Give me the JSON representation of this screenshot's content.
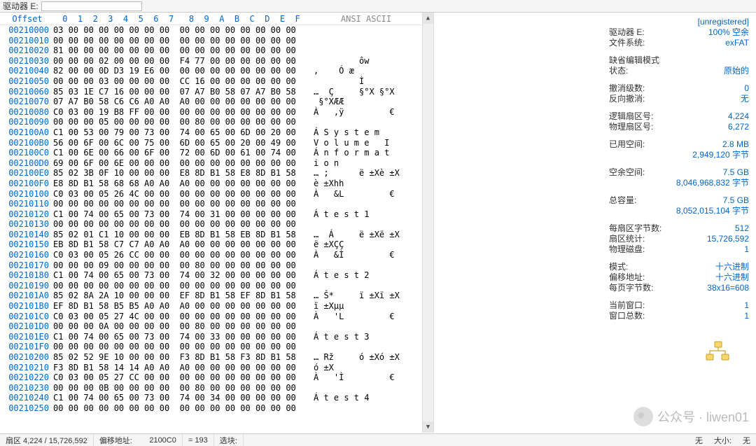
{
  "topbar": {
    "drive_label": "驱动器 E:",
    "drive_value": ""
  },
  "hex_header": {
    "offset": "Offset",
    "cols": " 0  1  2  3  4  5  6  7   8  9  A  B  C  D  E  F",
    "ascii": "ANSI ASCII"
  },
  "rows": [
    {
      "off": "00210000",
      "hx": "03 00 00 00 00 00 00 00  00 00 00 00 00 00 00 00",
      "asc": ""
    },
    {
      "off": "00210010",
      "hx": "00 00 00 00 00 00 00 00  00 00 00 00 00 00 00 00",
      "asc": ""
    },
    {
      "off": "00210020",
      "hx": "81 00 00 00 00 00 00 00  00 00 00 00 00 00 00 00",
      "asc": ""
    },
    {
      "off": "00210030",
      "hx": "00 00 00 02 00 00 00 00  F4 77 00 00 00 00 00 00",
      "asc": "         ôw"
    },
    {
      "off": "00210040",
      "hx": "82 00 00 0D D3 19 E6 00  00 00 00 00 00 00 00 00",
      "asc": ",    Ó æ"
    },
    {
      "off": "00210050",
      "hx": "00 00 00 03 00 00 00 00  CC 16 00 00 00 00 00 00",
      "asc": "         Ì"
    },
    {
      "off": "00210060",
      "hx": "85 03 1E C7 16 00 00 00  07 A7 B0 58 07 A7 B0 58",
      "asc": "…  Ç     §°X §°X"
    },
    {
      "off": "00210070",
      "hx": "07 A7 B0 58 C6 C6 A0 A0  A0 00 00 00 00 00 00 00",
      "asc": " §°XÆÆ"
    },
    {
      "off": "00210080",
      "hx": "C0 03 00 19 B8 FF 00 00  00 00 00 00 00 00 00 00",
      "asc": "À   ,ÿ         €"
    },
    {
      "off": "00210090",
      "hx": "00 00 00 05 00 00 00 00  00 80 00 00 00 00 00 00",
      "asc": ""
    },
    {
      "off": "002100A0",
      "hx": "C1 00 53 00 79 00 73 00  74 00 65 00 6D 00 20 00",
      "asc": "Á S y s t e m"
    },
    {
      "off": "002100B0",
      "hx": "56 00 6F 00 6C 00 75 00  6D 00 65 00 20 00 49 00",
      "asc": "V o l u m e   I"
    },
    {
      "off": "002100C0",
      "hx": "C1 00 6E 00 66 00 6F 00  72 00 6D 00 61 00 74 00",
      "asc": "Á n f o r m a t"
    },
    {
      "off": "002100D0",
      "hx": "69 00 6F 00 6E 00 00 00  00 00 00 00 00 00 00 00",
      "asc": "i o n"
    },
    {
      "off": "002100E0",
      "hx": "85 02 3B 0F 10 00 00 00  E8 8D B1 58 E8 8D B1 58",
      "asc": "… ;      ë ±Xè ±X"
    },
    {
      "off": "002100F0",
      "hx": "E8 8D B1 58 68 68 A0 A0  A0 00 00 00 00 00 00 00",
      "asc": "è ±Xhh"
    },
    {
      "off": "00210100",
      "hx": "C0 03 00 05 26 4C 00 00  00 00 00 00 00 00 00 00",
      "asc": "À   &L         €"
    },
    {
      "off": "00210110",
      "hx": "00 00 00 00 00 00 00 00  00 00 00 00 00 00 00 00",
      "asc": ""
    },
    {
      "off": "00210120",
      "hx": "C1 00 74 00 65 00 73 00  74 00 31 00 00 00 00 00",
      "asc": "Á t e s t 1"
    },
    {
      "off": "00210130",
      "hx": "00 00 00 00 00 00 00 00  00 00 00 00 00 00 00 00",
      "asc": ""
    },
    {
      "off": "00210140",
      "hx": "85 02 01 C1 10 00 00 00  EB 8D B1 58 EB 8D B1 58",
      "asc": "…  Á     ë ±Xë ±X"
    },
    {
      "off": "00210150",
      "hx": "EB 8D B1 58 C7 C7 A0 A0  A0 00 00 00 00 00 00 00",
      "asc": "ë ±XÇÇ"
    },
    {
      "off": "00210160",
      "hx": "C0 03 00 05 26 CC 00 00  00 00 00 00 00 00 00 00",
      "asc": "À   &Ì         €"
    },
    {
      "off": "00210170",
      "hx": "00 00 00 09 00 00 00 00  00 80 00 00 00 00 00 00",
      "asc": ""
    },
    {
      "off": "00210180",
      "hx": "C1 00 74 00 65 00 73 00  74 00 32 00 00 00 00 00",
      "asc": "Á t e s t 2"
    },
    {
      "off": "00210190",
      "hx": "00 00 00 00 00 00 00 00  00 00 00 00 00 00 00 00",
      "asc": ""
    },
    {
      "off": "002101A0",
      "hx": "85 02 8A 2A 10 00 00 00  EF 8D B1 58 EF 8D B1 58",
      "asc": "… Š*     ï ±Xï ±X"
    },
    {
      "off": "002101B0",
      "hx": "EF 8D B1 58 B5 B5 A0 A0  A0 00 00 00 00 00 00 00",
      "asc": "ï ±Xµµ"
    },
    {
      "off": "002101C0",
      "hx": "C0 03 00 05 27 4C 00 00  00 00 00 00 00 00 00 00",
      "asc": "À   'L         €"
    },
    {
      "off": "002101D0",
      "hx": "00 00 00 0A 00 00 00 00  00 80 00 00 00 00 00 00",
      "asc": ""
    },
    {
      "off": "002101E0",
      "hx": "C1 00 74 00 65 00 73 00  74 00 33 00 00 00 00 00",
      "asc": "Á t e s t 3"
    },
    {
      "off": "002101F0",
      "hx": "00 00 00 00 00 00 00 00  00 00 00 00 00 00 00 00",
      "asc": ""
    },
    {
      "off": "00210200",
      "hx": "85 02 52 9E 10 00 00 00  F3 8D B1 58 F3 8D B1 58",
      "asc": "… Rž     ó ±Xó ±X"
    },
    {
      "off": "00210210",
      "hx": "F3 8D B1 58 14 14 A0 A0  A0 00 00 00 00 00 00 00",
      "asc": "ó ±X"
    },
    {
      "off": "00210220",
      "hx": "C0 03 00 05 27 CC 00 00  00 00 00 00 00 00 00 00",
      "asc": "À   'Ì         €"
    },
    {
      "off": "00210230",
      "hx": "00 00 00 0B 00 00 00 00  00 80 00 00 00 00 00 00",
      "asc": ""
    },
    {
      "off": "00210240",
      "hx": "C1 00 74 00 65 00 73 00  74 00 34 00 00 00 00 00",
      "asc": "Á t e s t 4"
    },
    {
      "off": "00210250",
      "hx": "00 00 00 00 00 00 00 00  00 00 00 00 00 00 00 00",
      "asc": ""
    }
  ],
  "info": {
    "unregistered": "[unregistered]",
    "rows": [
      {
        "lbl": "驱动器 E:",
        "val": "100% 空余"
      },
      {
        "lbl": "文件系统:",
        "val": "exFAT"
      },
      {
        "sep": true
      },
      {
        "lbl": "缺省编辑模式",
        "val": ""
      },
      {
        "lbl": "状态:",
        "val": "原始的"
      },
      {
        "sep": true
      },
      {
        "lbl": "撤消级数:",
        "val": "0"
      },
      {
        "lbl": "反向撤消:",
        "val": "无"
      },
      {
        "sep": true
      },
      {
        "lbl": "逻辑扇区号:",
        "val": "4,224"
      },
      {
        "lbl": "物理扇区号:",
        "val": "6,272"
      },
      {
        "sep": true
      },
      {
        "lbl": "已用空间:",
        "val": "2.8 MB"
      },
      {
        "lbl": "",
        "val": "2,949,120 字节"
      },
      {
        "sep": true
      },
      {
        "lbl": "空余空间:",
        "val": "7.5 GB"
      },
      {
        "lbl": "",
        "val": "8,046,968,832 字节"
      },
      {
        "sep": true
      },
      {
        "lbl": "总容量:",
        "val": "7.5 GB"
      },
      {
        "lbl": "",
        "val": "8,052,015,104 字节"
      },
      {
        "sep": true
      },
      {
        "lbl": "每扇区字节数:",
        "val": "512"
      },
      {
        "lbl": "扇区统计:",
        "val": "15,726,592"
      },
      {
        "lbl": "物理磁盘:",
        "val": "1"
      },
      {
        "sep": true
      },
      {
        "lbl": "模式:",
        "val": "十六进制"
      },
      {
        "lbl": "偏移地址:",
        "val": "十六进制"
      },
      {
        "lbl": "每页字节数:",
        "val": "38x16=608"
      },
      {
        "sep": true
      },
      {
        "lbl": "当前窗口:",
        "val": "1"
      },
      {
        "lbl": "窗口总数:",
        "val": "1"
      }
    ]
  },
  "status": {
    "sector": "扇区 4,224 / 15,726,592",
    "offset_lbl": "偏移地址:",
    "offset_val": "2100C0",
    "eq": "= 193",
    "block_lbl": "选块:",
    "block_val": "无",
    "size_lbl": "大小:",
    "size_val": "无"
  },
  "watermark": "公众号 · liwen01"
}
